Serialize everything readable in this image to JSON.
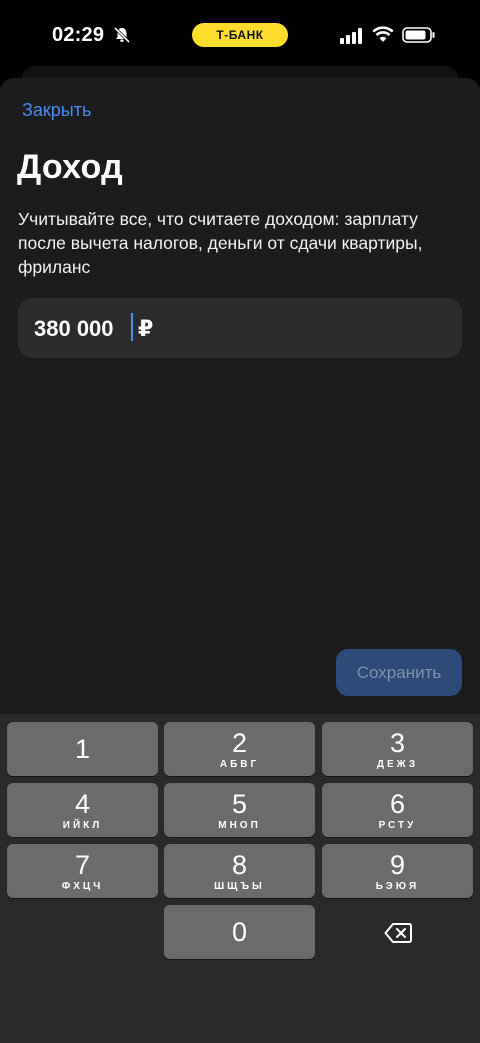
{
  "status_bar": {
    "time": "02:29",
    "carrier_pill": "Т-БАНК",
    "icons": [
      "bell-muted-icon",
      "signal-icon",
      "wifi-icon",
      "battery-icon"
    ]
  },
  "sheet": {
    "close_label": "Закрыть",
    "title": "Доход",
    "description": "Учитывайте все, что считаете доходом: зарплату после вычета налогов, деньги от сдачи квартиры, фриланс",
    "amount_value": "380 000",
    "currency_symbol": "₽",
    "save_label": "Сохранить"
  },
  "keyboard": {
    "keys": [
      {
        "digit": "1",
        "letters": ""
      },
      {
        "digit": "2",
        "letters": "АБВГ"
      },
      {
        "digit": "3",
        "letters": "ДЕЖЗ"
      },
      {
        "digit": "4",
        "letters": "ИЙКЛ"
      },
      {
        "digit": "5",
        "letters": "МНОП"
      },
      {
        "digit": "6",
        "letters": "РСТУ"
      },
      {
        "digit": "7",
        "letters": "ФХЦЧ"
      },
      {
        "digit": "8",
        "letters": "ШЩЪЫ"
      },
      {
        "digit": "9",
        "letters": "ЬЭЮЯ"
      },
      {
        "digit": "0",
        "letters": ""
      }
    ],
    "backspace_icon": "backspace-icon"
  },
  "colors": {
    "accent": "#4a8ef0",
    "pill": "#ffdd2d",
    "sheet": "#1c1c1e",
    "key": "#6b6b6e"
  }
}
